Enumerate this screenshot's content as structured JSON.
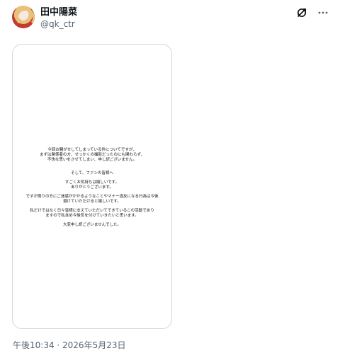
{
  "author": {
    "display_name": "田中陽菜",
    "handle": "@qk_ctr"
  },
  "icons": {
    "grok": "grok-icon",
    "more": "more-icon"
  },
  "image_text": {
    "paragraph_1": [
      "今回お騒がせしてしまっている件についてですが、",
      "まずは関係者の方、せっかくの撮影だったのにも関わらず、",
      "不快な思いをさせてしまい、申し訳ございません。"
    ],
    "paragraph_2": [
      "そして、ファンの皆様へ"
    ],
    "paragraph_3": [
      "すごくお気持ちは嬉しいです。",
      "ありがとうございます。"
    ],
    "paragraph_4": [
      "ですが周りの方にご迷惑がかかるようなことやマナー違反になる行為は今後",
      "避けていただけると嬉しいです。"
    ],
    "paragraph_5": [
      "私だけではなく日々皆様に支えていただいてできているこの活動であり",
      "ますので私含め今後気を付けていきたいと思います。"
    ],
    "paragraph_6": [
      "大変申し訳ございませんでした。"
    ]
  },
  "timestamp": "午後10:34 · 2026年5月23日",
  "colors": {
    "text_primary": "#0f1419",
    "text_secondary": "#536471",
    "border": "#cfd9de"
  }
}
